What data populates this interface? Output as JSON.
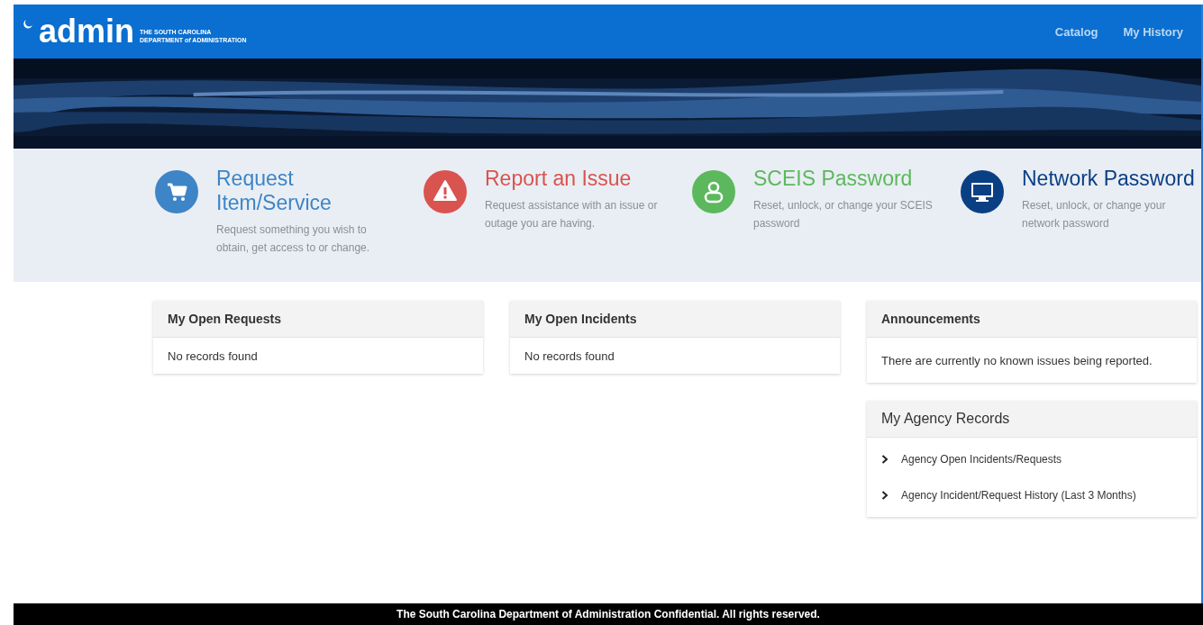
{
  "header": {
    "logo_word": "admin",
    "logo_line_1": "THE SOUTH CAROLINA",
    "logo_line_2": "DEPARTMENT *of* ADMINISTRATION",
    "nav": [
      "Catalog",
      "My History"
    ]
  },
  "tiles": [
    {
      "kind": "cart",
      "color": "#3d85c6",
      "title": "Request Item/Service",
      "description": "Request something you wish to obtain, get access to or change."
    },
    {
      "kind": "warning",
      "color": "#d9534f",
      "title": "Report an Issue",
      "description": "Request assistance with an issue or outage you are having."
    },
    {
      "kind": "person",
      "color": "#5cb85c",
      "title": "SCEIS Password",
      "description": "Reset, unlock, or change your SCEIS password"
    },
    {
      "kind": "monitor",
      "color": "#0b3f84",
      "title": "Network Password",
      "description": "Reset, unlock, or change your network password"
    }
  ],
  "panels": [
    {
      "title": "My Open Requests",
      "message": "No records found"
    },
    {
      "title": "My Open Incidents",
      "message": "No records found"
    },
    {
      "title": "Announcements",
      "message": "There are currently no known issues being reported."
    },
    {
      "title": "My Agency Records",
      "links": [
        "Agency Open Incidents/Requests",
        "Agency Incident/Request History (Last 3 Months)"
      ]
    }
  ],
  "footer": "The South Carolina Department of Administration Confidential. All rights reserved."
}
